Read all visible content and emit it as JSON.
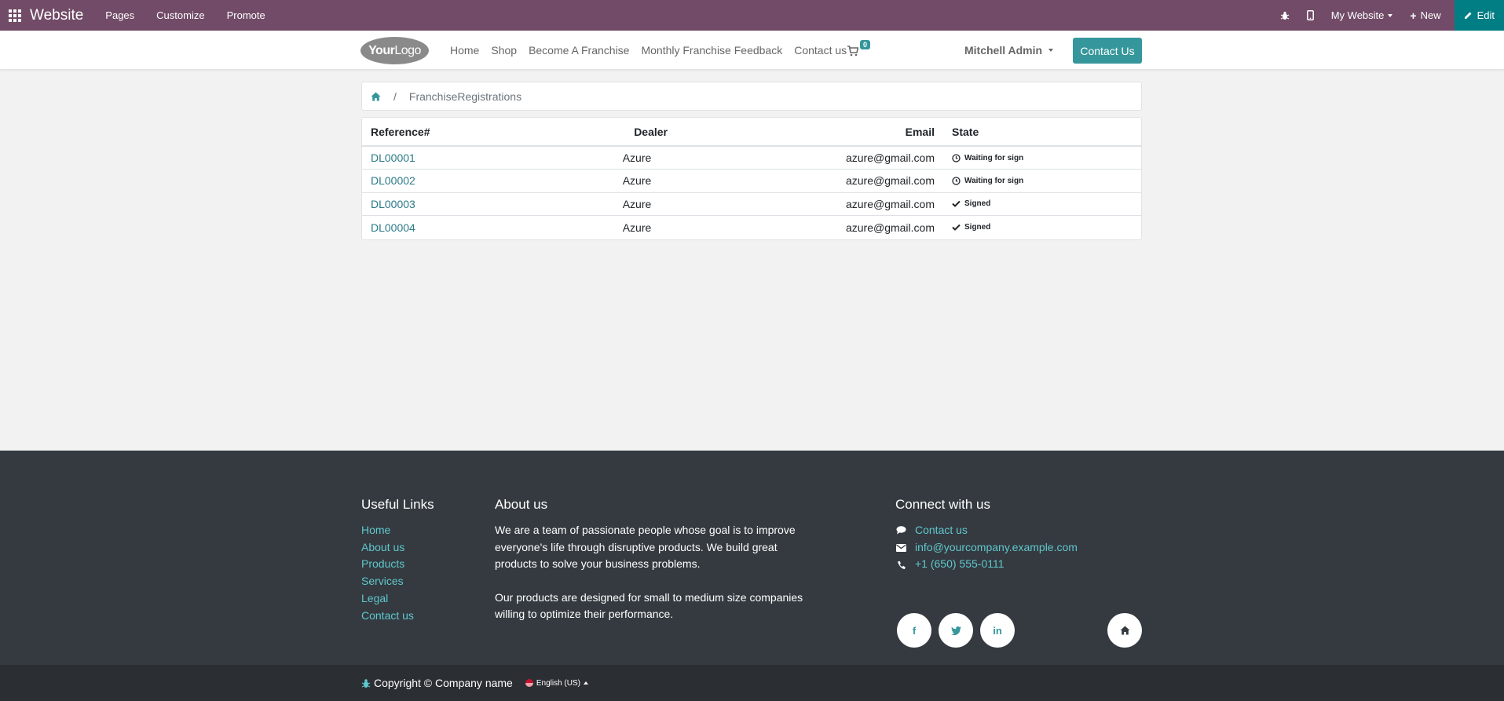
{
  "admin_bar": {
    "brand": "Website",
    "menus": [
      "Pages",
      "Customize",
      "Promote"
    ],
    "my_website": "My Website",
    "new_label": "New",
    "edit_label": "Edit"
  },
  "header": {
    "logo_bold": "Your",
    "logo_rest": "Logo",
    "nav": [
      "Home",
      "Shop",
      "Become A Franchise",
      "Monthly Franchise Feedback",
      "Contact us"
    ],
    "cart_count": "0",
    "user": "Mitchell Admin",
    "contact_button": "Contact Us"
  },
  "breadcrumb": {
    "current": "FranchiseRegistrations"
  },
  "table": {
    "columns": [
      "Reference#",
      "Dealer",
      "Email",
      "State"
    ],
    "rows": [
      {
        "ref": "DL00001",
        "dealer": "Azure",
        "email": "azure@gmail.com",
        "state": "Waiting for sign",
        "state_icon": "clock-icon"
      },
      {
        "ref": "DL00002",
        "dealer": "Azure",
        "email": "azure@gmail.com",
        "state": "Waiting for sign",
        "state_icon": "clock-icon"
      },
      {
        "ref": "DL00003",
        "dealer": "Azure",
        "email": "azure@gmail.com",
        "state": "Signed",
        "state_icon": "check-icon"
      },
      {
        "ref": "DL00004",
        "dealer": "Azure",
        "email": "azure@gmail.com",
        "state": "Signed",
        "state_icon": "check-icon"
      }
    ]
  },
  "footer": {
    "useful_links_title": "Useful Links",
    "useful_links": [
      "Home",
      "About us",
      "Products",
      "Services",
      "Legal",
      "Contact us"
    ],
    "about_title": "About us",
    "about_p1": "We are a team of passionate people whose goal is to improve everyone's life through disruptive products. We build great products to solve your business problems.",
    "about_p2": "Our products are designed for small to medium size companies willing to optimize their performance.",
    "connect_title": "Connect with us",
    "contact_link": "Contact us",
    "email": "info@yourcompany.example.com",
    "phone": "+1 (650) 555-0111",
    "social_icons": [
      "facebook-icon",
      "twitter-icon",
      "linkedin-icon",
      "home-icon"
    ]
  },
  "copyright": {
    "text": "Copyright © Company name",
    "language": "English (US)"
  },
  "colors": {
    "admin_bar": "#714b67",
    "edit_button": "#017e84",
    "accent": "#35979c",
    "footer_bg": "#343a40",
    "link": "#5fc8cd"
  }
}
